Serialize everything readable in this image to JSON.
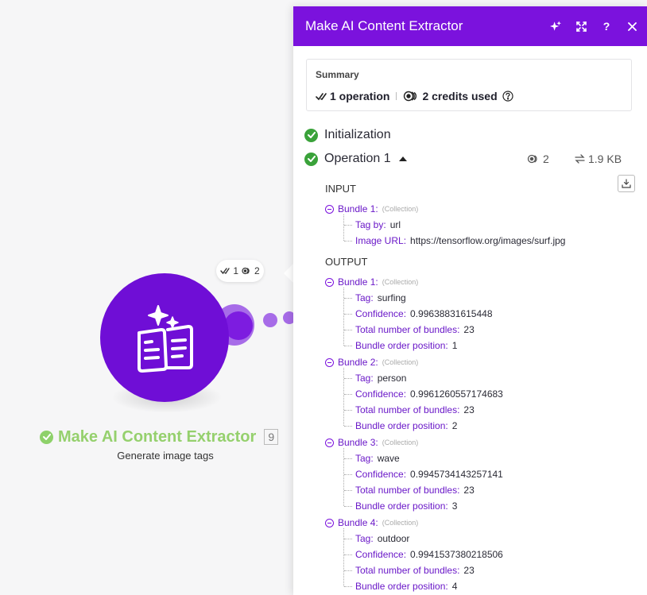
{
  "canvas": {
    "bubble": {
      "operations": "1",
      "credits": "2"
    },
    "node": {
      "title": "Make AI Content Extractor",
      "id": "9",
      "subtitle": "Generate image tags",
      "color": "#6f0ed6",
      "title_color": "#95d06d"
    }
  },
  "panel": {
    "title": "Make AI Content Extractor",
    "header_color": "#7b12dd",
    "summary": {
      "label": "Summary",
      "operations": "1 operation",
      "credits": "2 credits used"
    },
    "initialization": "Initialization",
    "operation": {
      "label": "Operation 1",
      "credits": "2",
      "size": "1.9 KB"
    },
    "input": {
      "label": "INPUT",
      "bundles": [
        {
          "name": "Bundle 1:",
          "type": "(Collection)",
          "fields": [
            {
              "key": "Tag by:",
              "value": "url"
            },
            {
              "key": "Image URL:",
              "value": "https://tensorflow.org/images/surf.jpg"
            }
          ]
        }
      ]
    },
    "output": {
      "label": "OUTPUT",
      "bundles": [
        {
          "name": "Bundle 1:",
          "type": "(Collection)",
          "fields": [
            {
              "key": "Tag:",
              "value": "surfing"
            },
            {
              "key": "Confidence:",
              "value": "0.99638831615448"
            },
            {
              "key": "Total number of bundles:",
              "value": "23"
            },
            {
              "key": "Bundle order position:",
              "value": "1"
            }
          ]
        },
        {
          "name": "Bundle 2:",
          "type": "(Collection)",
          "fields": [
            {
              "key": "Tag:",
              "value": "person"
            },
            {
              "key": "Confidence:",
              "value": "0.9961260557174683"
            },
            {
              "key": "Total number of bundles:",
              "value": "23"
            },
            {
              "key": "Bundle order position:",
              "value": "2"
            }
          ]
        },
        {
          "name": "Bundle 3:",
          "type": "(Collection)",
          "fields": [
            {
              "key": "Tag:",
              "value": "wave"
            },
            {
              "key": "Confidence:",
              "value": "0.9945734143257141"
            },
            {
              "key": "Total number of bundles:",
              "value": "23"
            },
            {
              "key": "Bundle order position:",
              "value": "3"
            }
          ]
        },
        {
          "name": "Bundle 4:",
          "type": "(Collection)",
          "fields": [
            {
              "key": "Tag:",
              "value": "outdoor"
            },
            {
              "key": "Confidence:",
              "value": "0.9941537380218506"
            },
            {
              "key": "Total number of bundles:",
              "value": "23"
            },
            {
              "key": "Bundle order position:",
              "value": "4"
            }
          ]
        }
      ]
    }
  }
}
